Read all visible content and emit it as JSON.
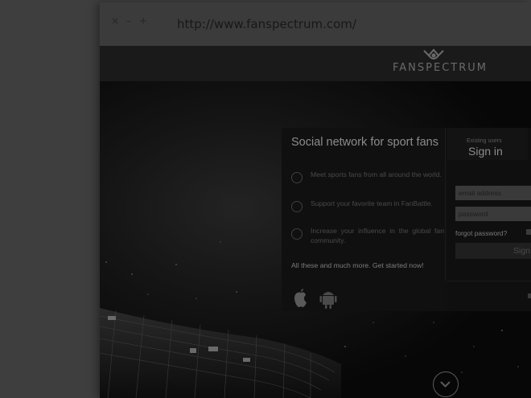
{
  "browser": {
    "url": "http://www.fanspectrum.com/",
    "close_glyph": "×",
    "minimize_glyph": "–",
    "maximize_glyph": "+"
  },
  "site": {
    "logo_text": "FANSPECTRUM",
    "logo_icon": "fan-crown-icon"
  },
  "panel": {
    "title": "Social network for sport fans",
    "features": [
      {
        "icon": "globe-people-icon",
        "text": "Meet sports fans from all around the world."
      },
      {
        "icon": "support-team-icon",
        "text": "Support your favorite team in FanBattle."
      },
      {
        "icon": "medal-icon",
        "text": "Increase your influence in the global fan community."
      }
    ],
    "cta": "All these and much more. Get started now!",
    "store_icons": [
      "apple-icon",
      "android-icon"
    ]
  },
  "signin": {
    "existing_label": "Existing users",
    "title": "Sign in",
    "email_placeholder": "email address",
    "password_placeholder": "password",
    "forgot_label": "forgot password?",
    "button_label": "Sign"
  },
  "hero": {
    "scroll_icon": "chevron-down-icon"
  },
  "colors": {
    "overlay": "#3e3e3e",
    "panel_bg": "#101010",
    "input_bg": "#3a3a3a"
  }
}
